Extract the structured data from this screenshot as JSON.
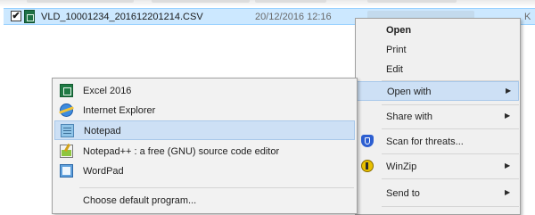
{
  "file_list": {
    "selected_file": {
      "checkbox_mark": "✔",
      "name": "VLD_10001234_201612201214.CSV",
      "date_modified": "20/12/2016 12:16",
      "size_partial": "K"
    }
  },
  "context_menu": {
    "items": [
      {
        "label": "Open",
        "bold": true
      },
      {
        "label": "Print"
      },
      {
        "label": "Edit"
      },
      {
        "label": "Open with",
        "submenu": true,
        "highlighted": true
      },
      {
        "label": "Share with",
        "submenu": true
      },
      {
        "label": "Scan for threats...",
        "icon": "shield-icon"
      },
      {
        "label": "WinZip",
        "submenu": true,
        "icon": "winzip-icon"
      },
      {
        "label": "Send to",
        "submenu": true
      }
    ],
    "submenu_arrow": "▶"
  },
  "open_with_submenu": {
    "items": [
      {
        "label": "Excel 2016",
        "icon": "excel-icon"
      },
      {
        "label": "Internet Explorer",
        "icon": "internet-explorer-icon"
      },
      {
        "label": "Notepad",
        "icon": "notepad-icon",
        "highlighted": true
      },
      {
        "label": "Notepad++ : a free (GNU) source code editor",
        "icon": "notepad-plus-plus-icon"
      },
      {
        "label": "WordPad",
        "icon": "wordpad-icon"
      }
    ],
    "footer_item": {
      "label": "Choose default program..."
    }
  },
  "colors": {
    "selection_row": "#cce8ff",
    "menu_hover": "#cde0f5",
    "menu_background": "#f0f0f0"
  }
}
